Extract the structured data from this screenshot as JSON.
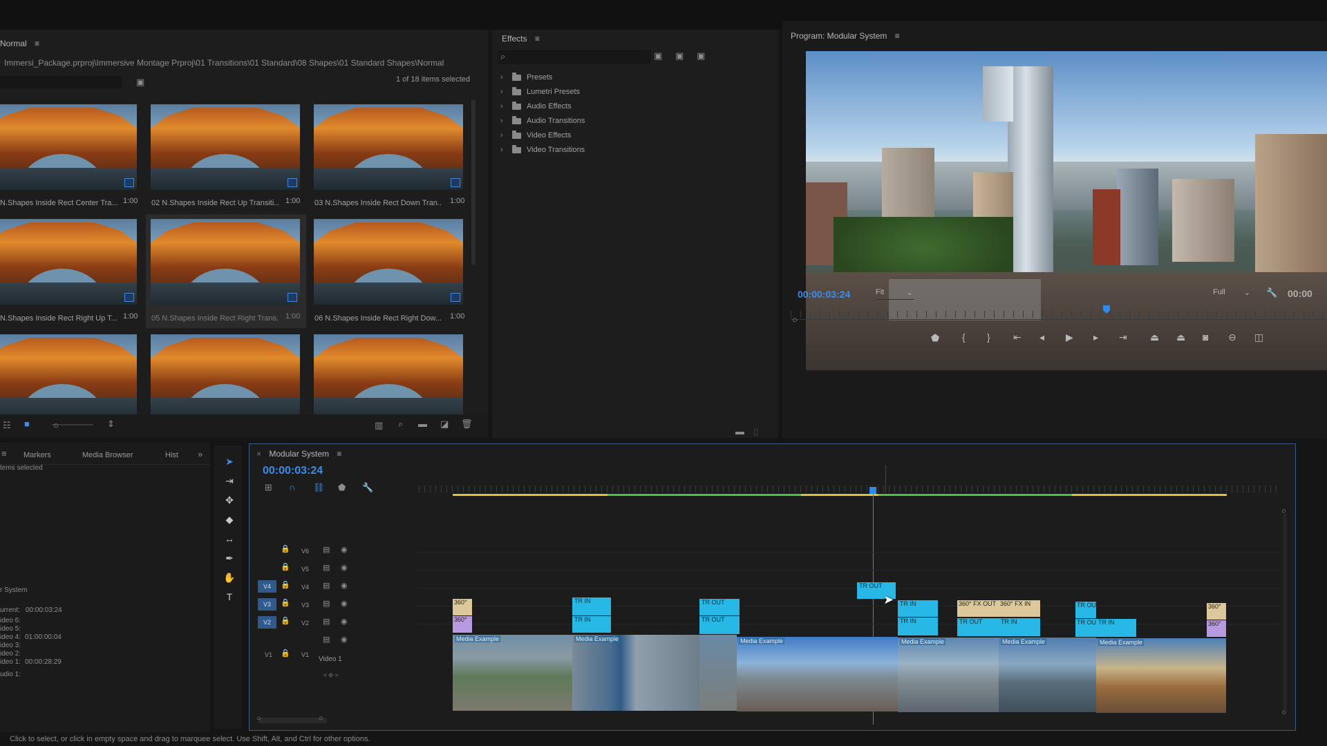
{
  "project": {
    "title": "Normal",
    "path": "Immersi_Package.prproj\\Immersive Montage Prproj\\01 Transitions\\01 Standard\\08 Shapes\\01 Standard Shapes\\Normal",
    "items_status": "1 of 18 items selected",
    "items": [
      {
        "name": "N.Shapes Inside Rect Center Tra...",
        "dur": "1:00"
      },
      {
        "name": "02 N.Shapes Inside Rect Up Transiti...",
        "dur": "1:00"
      },
      {
        "name": "03 N.Shapes Inside Rect Down Tran...",
        "dur": "1:00"
      },
      {
        "name": "N.Shapes Inside Rect Right Up T...",
        "dur": "1:00"
      },
      {
        "name": "05 N.Shapes Inside Rect Right Trans...",
        "dur": "1:00"
      },
      {
        "name": "06 N.Shapes Inside Rect Right Dow...",
        "dur": "1:00"
      },
      {
        "name": "",
        "dur": ""
      },
      {
        "name": "",
        "dur": ""
      },
      {
        "name": "",
        "dur": ""
      }
    ]
  },
  "effects": {
    "title": "Effects",
    "folders": [
      "Presets",
      "Lumetri Presets",
      "Audio Effects",
      "Audio Transitions",
      "Video Effects",
      "Video Transitions"
    ]
  },
  "program": {
    "title": "Program: Modular System",
    "timecode": "00:00:03:24",
    "fit": "Fit",
    "quality": "Full",
    "duration": "00:00"
  },
  "lower_left": {
    "tabs": [
      "Markers",
      "Media Browser",
      "Hist"
    ],
    "items_selected": "tems selected",
    "seq_name": "r System",
    "meta": [
      {
        "k": "urrent:",
        "v": "00:00:03:24"
      },
      {
        "k": "ideo 6:",
        "v": ""
      },
      {
        "k": "ideo 5:",
        "v": ""
      },
      {
        "k": "ideo 4:",
        "v": "01:00:00:04"
      },
      {
        "k": "ideo 3:",
        "v": ""
      },
      {
        "k": "ideo 2:",
        "v": ""
      },
      {
        "k": "ideo 1:",
        "v": "00:00:28:29"
      },
      {
        "k": "udio 1:",
        "v": ""
      }
    ]
  },
  "timeline": {
    "title": "Modular System",
    "timecode": "00:00:03:24",
    "tracks": [
      "V6",
      "V5",
      "V4",
      "V3",
      "V2",
      "V1"
    ],
    "v1_name": "Video 1",
    "clips": {
      "tr_in": "TR IN",
      "tr_out": "TR OUT",
      "fx_out": "360° FX OUT",
      "fx_in": "360° FX IN",
      "s360": "360°",
      "media": "Media Example",
      "tr_ou": "TR OU"
    }
  },
  "status_bar": "Click to select, or click in empty space and drag to marquee select. Use Shift, Alt, and Ctrl for other options.",
  "colors": {
    "accent": "#2d8ceb",
    "clip_fx": "#28b8e6",
    "clip_yellow": "#dcc89a",
    "clip_purple": "#b79be0"
  }
}
